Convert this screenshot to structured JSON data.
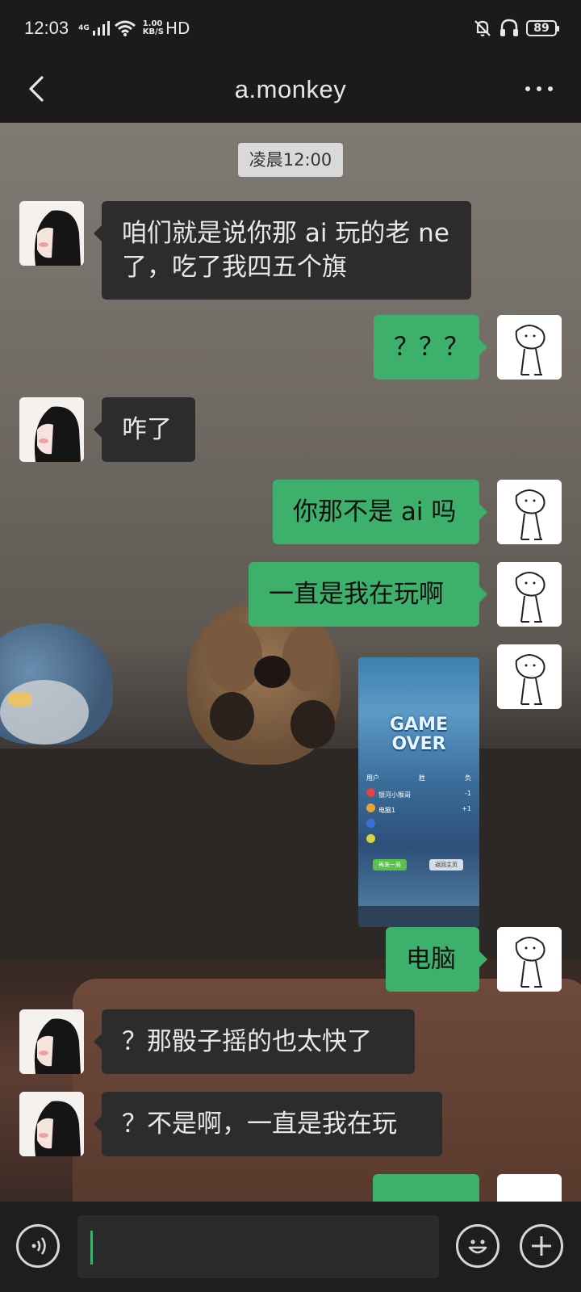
{
  "status_bar": {
    "time": "12:03",
    "network": "4G",
    "speed_value": "1.00",
    "speed_unit": "KB/S",
    "hd": "HD",
    "battery": "89"
  },
  "header": {
    "title": "a.monkey"
  },
  "chat": {
    "timestamp": "凌晨12:00",
    "messages": [
      {
        "side": "other",
        "text": "咱们就是说你那 ai 玩的老 ne\n了，吃了我四五个旗"
      },
      {
        "side": "me",
        "text": "？？？"
      },
      {
        "side": "other",
        "text": "咋了"
      },
      {
        "side": "me",
        "text": "你那不是 ai 吗"
      },
      {
        "side": "me",
        "text": "一直是我在玩啊"
      },
      {
        "side": "me",
        "type": "image"
      },
      {
        "side": "me",
        "text": "电脑"
      },
      {
        "side": "other",
        "text": "？那骰子摇的也太快了"
      },
      {
        "side": "other",
        "text": "？不是啊，一直是我在玩"
      }
    ],
    "game_image": {
      "title": "GAME\nOVER",
      "headers": [
        "用户",
        "胜",
        "负"
      ],
      "rows": [
        {
          "name": "银河小猴哥",
          "value": "-1"
        },
        {
          "name": "电脑1",
          "value": "+1"
        },
        {
          "name": "",
          "value": ""
        },
        {
          "name": "",
          "value": ""
        }
      ],
      "button_again": "再来一局",
      "button_home": "返回主页"
    }
  },
  "input_bar": {
    "value": ""
  },
  "colors": {
    "my_bubble": "#3db06b",
    "other_bubble": "#2c2c2c",
    "bar_background": "#1b1b1b"
  }
}
